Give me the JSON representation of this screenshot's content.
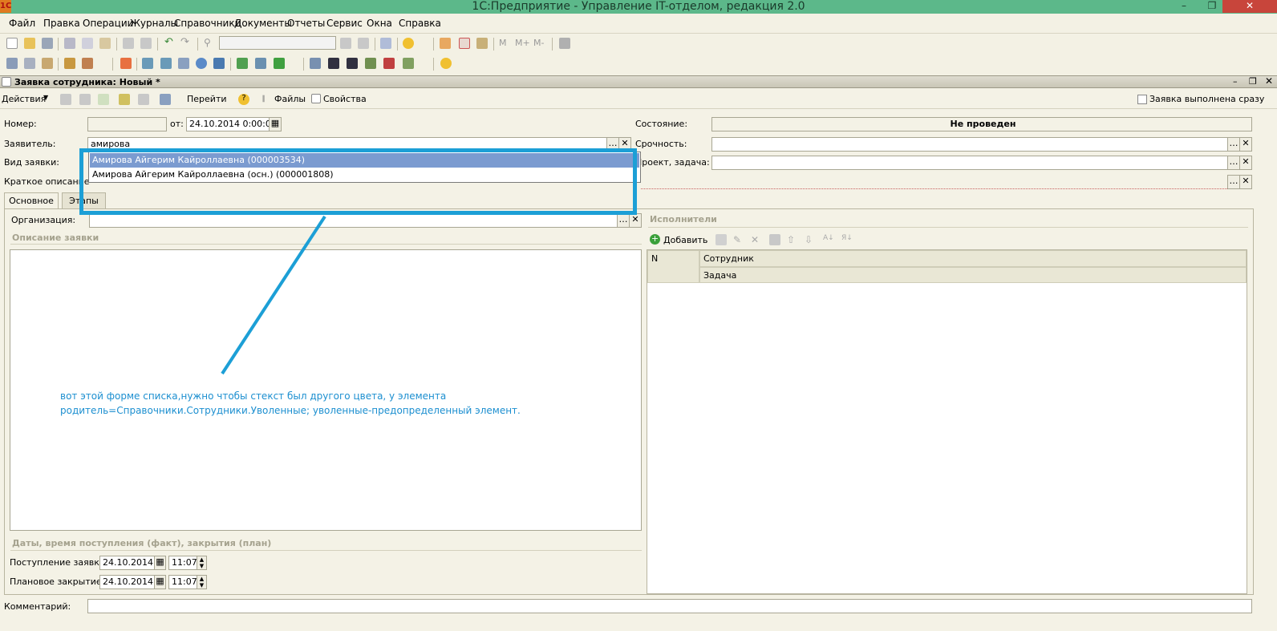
{
  "window": {
    "title": "1С:Предприятие - Управление IT-отделом, редакция 2.0",
    "logo": "1С"
  },
  "menu": [
    "Файл",
    "Правка",
    "Операции",
    "Журналы",
    "Справочники",
    "Документы",
    "Отчеты",
    "Сервис",
    "Окна",
    "Справка"
  ],
  "doc": {
    "title": "Заявка сотрудника: Новый *",
    "toolbar": {
      "actions": "Действия",
      "goto": "Перейти",
      "files": "Файлы",
      "props": "Свойства",
      "done_checkbox": "Заявка выполнена сразу"
    },
    "fields": {
      "number_label": "Номер:",
      "number_value": "",
      "from_label": "от:",
      "date_value": "24.10.2014  0:00:00",
      "applicant_label": "Заявитель:",
      "applicant_value": "амирова",
      "type_label": "Вид заявки:",
      "short_desc_label": "Краткое описание",
      "state_label": "Состояние:",
      "state_value": "Не проведен",
      "urgency_label": "Срочность:",
      "project_label": "Проект, задача:",
      "comment_label": "Комментарий:"
    },
    "dropdown": [
      "Амирова Айгерим Кайроллаевна (000003534)",
      "Амирова Айгерим Кайроллаевна (осн.) (000001808)"
    ],
    "tabs": [
      "Основное",
      "Этапы"
    ],
    "org_label": "Организация:",
    "desc_group": "Описание заявки",
    "dates_group": "Даты, время поступления (факт), закрытия (план)",
    "received_label": "Поступление заявки:",
    "received_date": "24.10.2014",
    "received_time": "11:07",
    "planned_label": "Плановое закрытие:",
    "planned_date": "24.10.2014",
    "planned_time": "11:07",
    "executors": {
      "title": "Исполнители",
      "add": "Добавить",
      "col_n": "N",
      "col_employee": "Сотрудник",
      "col_task": "Задача"
    }
  },
  "annotation": {
    "line1": "вот этой форме списка,нужно чтобы стекст был другого цвета, у элемента",
    "line2": "родитель=Справочники.Сотрудники.Уволенные; уволенные-предопределенный элемент."
  },
  "colors": {
    "highlight": "#1c9fd6",
    "selected_row": "#7b9bd0"
  }
}
